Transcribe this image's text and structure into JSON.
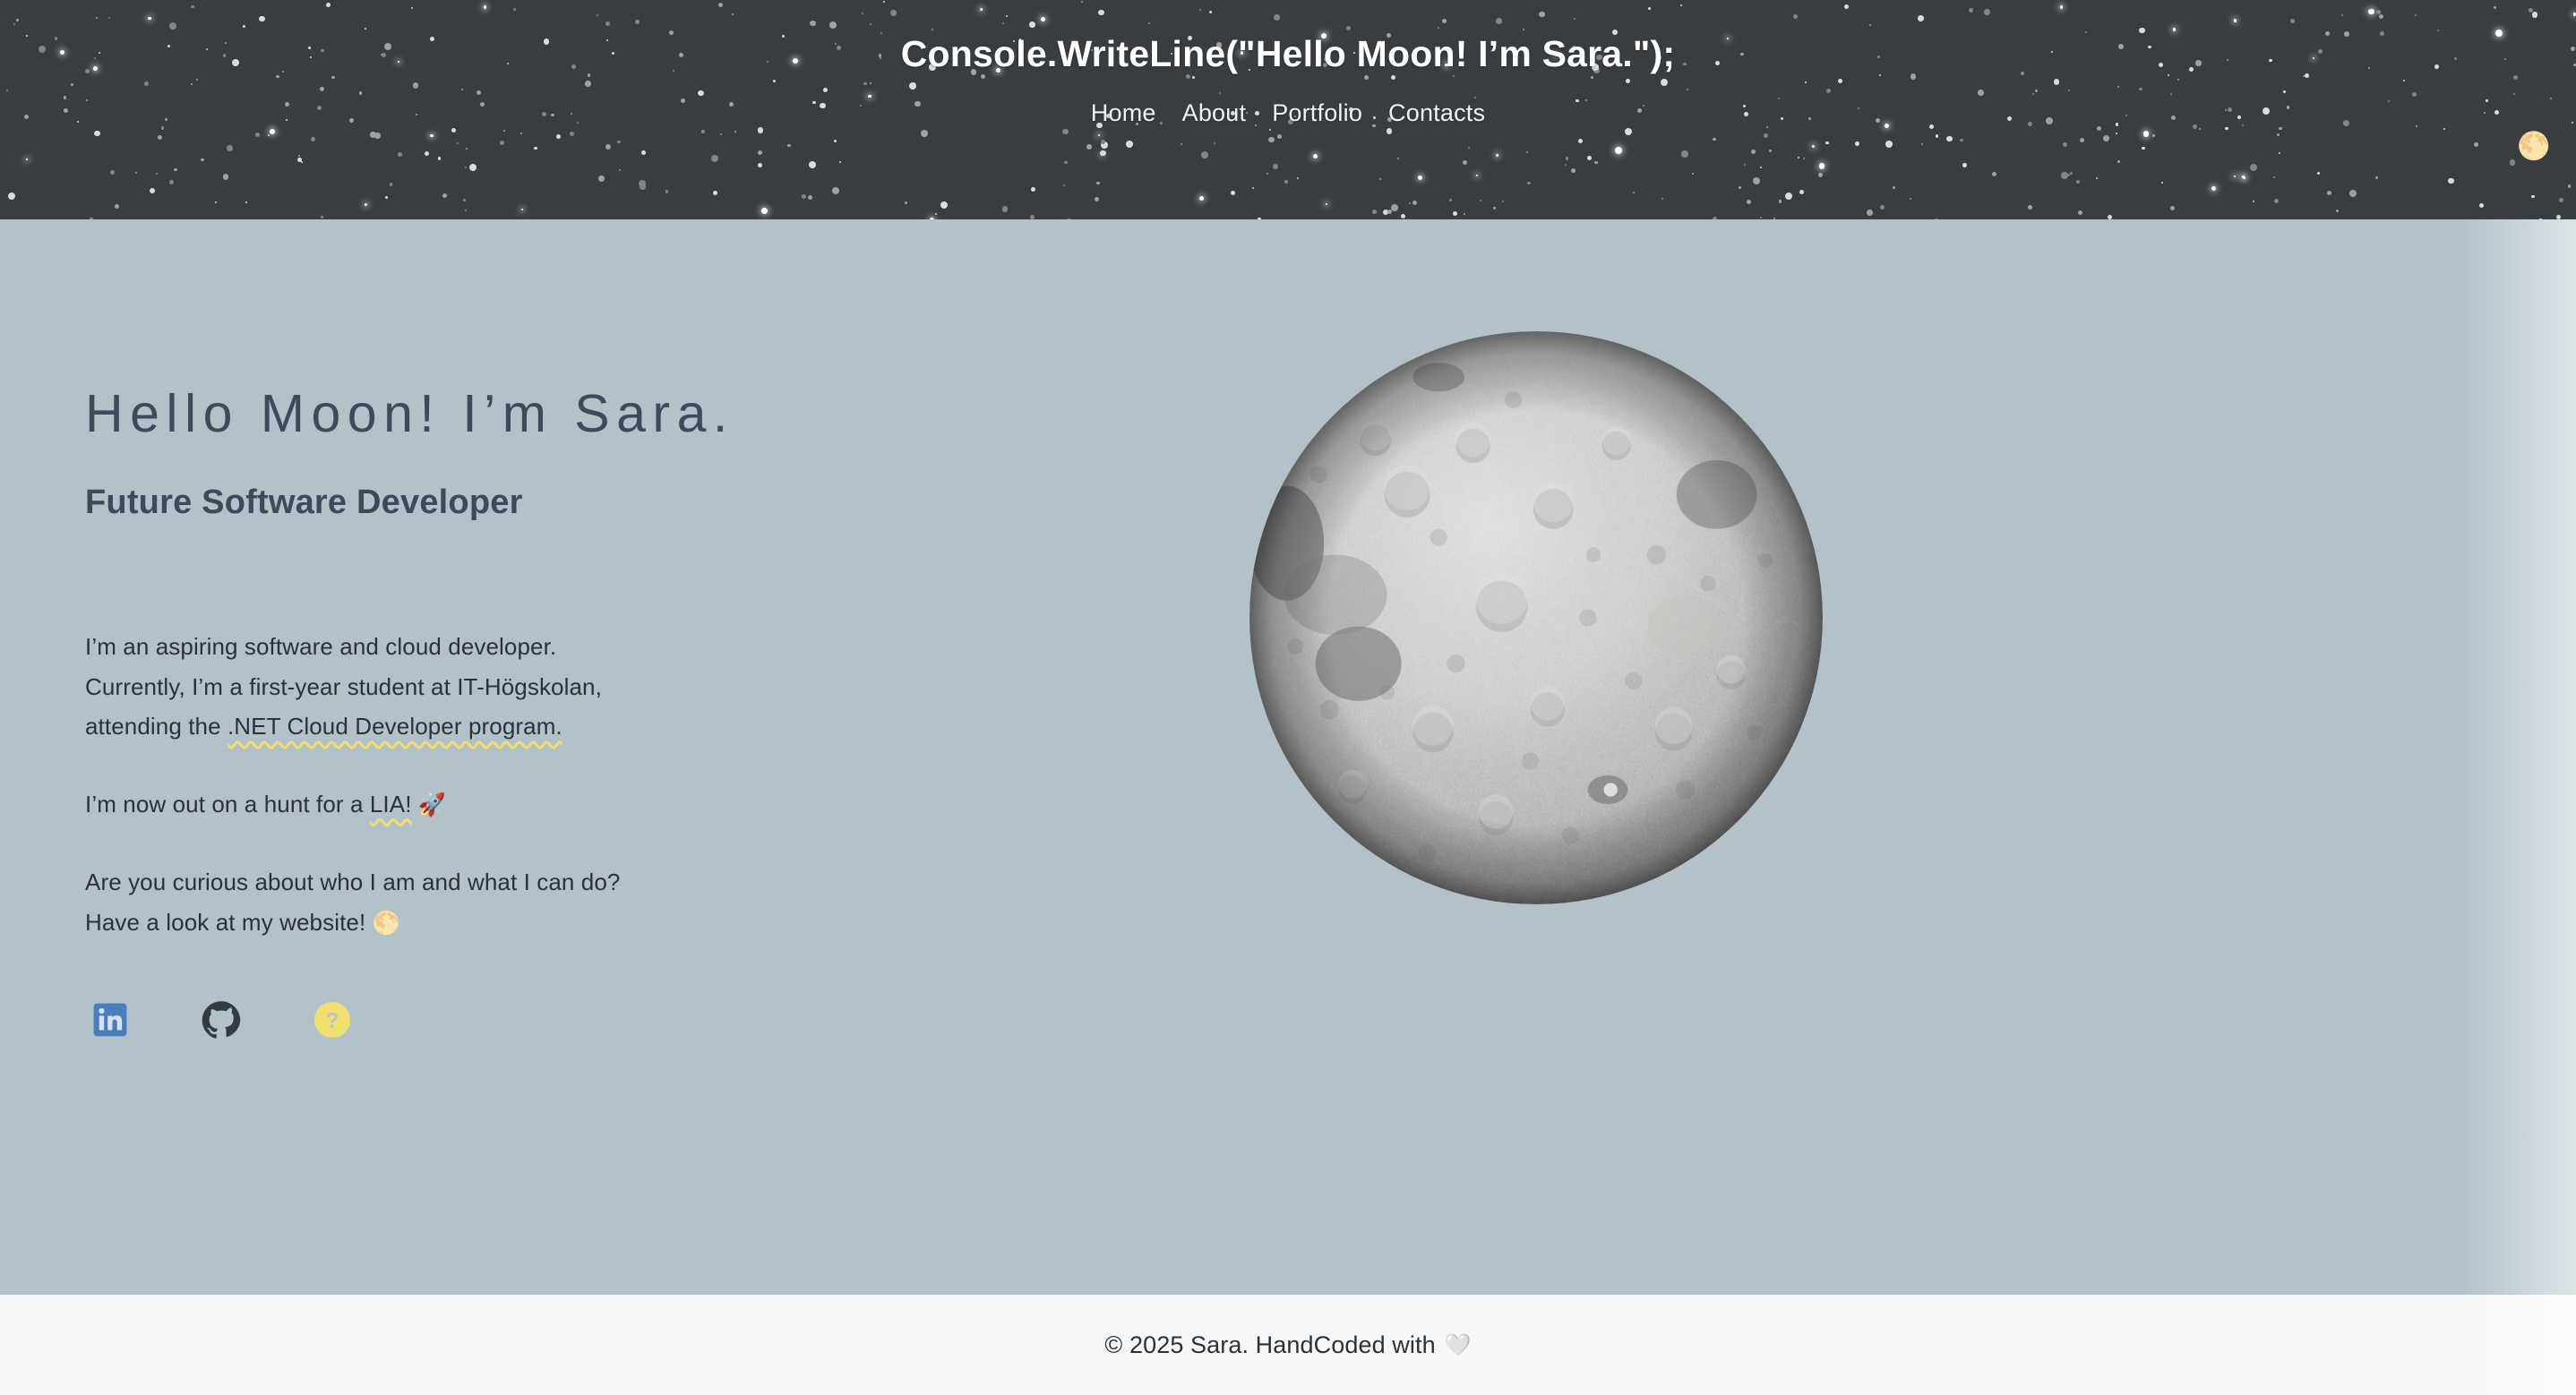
{
  "header": {
    "brand_title": "Console.WriteLine(\"Hello Moon! I’m Sara.\");",
    "nav": [
      {
        "label": "Home"
      },
      {
        "label": "About"
      },
      {
        "label": "Portfolio"
      },
      {
        "label": "Contacts"
      }
    ],
    "theme_toggle_icon": "full-moon-emoji",
    "theme_toggle_glyph": "🌕",
    "background_color": "#383d41",
    "text_color": "#ffffff"
  },
  "hero": {
    "title": "Hello Moon! I’m Sara.",
    "subtitle": "Future Software Developer",
    "paragraph_1": {
      "line_1": "I’m an aspiring software and cloud developer.",
      "line_2": "Currently, I’m a first-year student at IT-Högskolan,",
      "line_3_prefix": "attending the ",
      "line_3_highlight": ".NET Cloud Developer program."
    },
    "paragraph_2": {
      "prefix": "I’m now out on a hunt for a ",
      "highlight": "LIA!",
      "emoji": "🚀",
      "emoji_name": "rocket-emoji"
    },
    "paragraph_3": {
      "line_1": "Are you curious about who I am and what I can do?",
      "line_2": "Have a look at my website!",
      "emoji": "🌕",
      "emoji_name": "full-moon-emoji"
    },
    "social_links": [
      {
        "name": "linkedin",
        "label": "LinkedIn",
        "color": "#4a7ebb"
      },
      {
        "name": "github",
        "label": "GitHub",
        "color": "#333a40"
      },
      {
        "name": "unknown",
        "label": "?",
        "color": "#f2e06e"
      }
    ],
    "moon_image_alt": "full moon far side photograph",
    "background_color": "#b3c2ca",
    "heading_color": "#3d4a57",
    "accent_color": "#f2dd6e"
  },
  "footer": {
    "text": "© 2025 Sara. HandCoded with",
    "heart_glyph": "🤍",
    "heart_name": "white-heart-emoji",
    "background_color": "#f6f8fa"
  }
}
